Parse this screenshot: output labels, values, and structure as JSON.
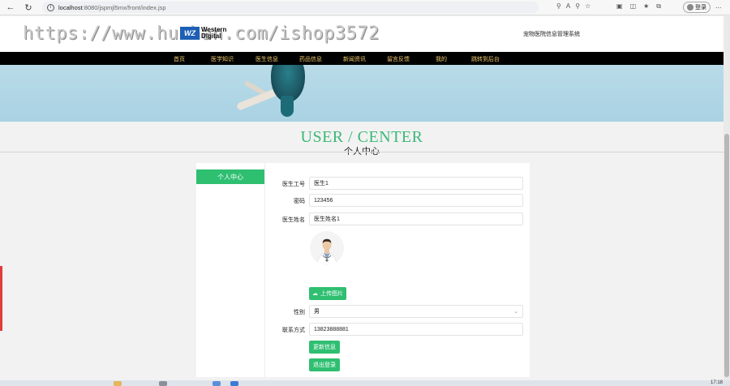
{
  "browser": {
    "url_host": "localhost",
    "url_path": ":8080/jspmjl5mx/front/index.jsp",
    "login_label": "登录",
    "more_label": "..."
  },
  "header": {
    "watermark": "https://www.huzhan.com/ishop3572",
    "logo_box": "WZ",
    "logo_line1": "Western",
    "logo_line2": "Digital",
    "system_name": "宠物医院信息管理系统"
  },
  "nav": {
    "items": [
      "首页",
      "医学知识",
      "医生信息",
      "药品信息",
      "新闻资讯",
      "留言反馈",
      "我的",
      "跳转到后台"
    ]
  },
  "page": {
    "title_en": "USER / CENTER",
    "title_cn": "个人中心"
  },
  "sidebar": {
    "active_tab": "个人中心"
  },
  "form": {
    "doctor_id_label": "医生工号",
    "doctor_id_value": "医生1",
    "password_label": "密码",
    "password_value": "123456",
    "doctor_name_label": "医生姓名",
    "doctor_name_value": "医生姓名1",
    "upload_label": "上传图片",
    "gender_label": "性别",
    "gender_value": "男",
    "phone_label": "联系方式",
    "phone_value": "13823888881",
    "update_label": "更新信息",
    "logout_label": "退出登录"
  },
  "taskbar": {
    "clock": "17:18"
  },
  "colors": {
    "accent": "#2fbf71",
    "title_green": "#3cb878",
    "nav_bg": "#000000",
    "nav_text": "#f0c96b"
  }
}
